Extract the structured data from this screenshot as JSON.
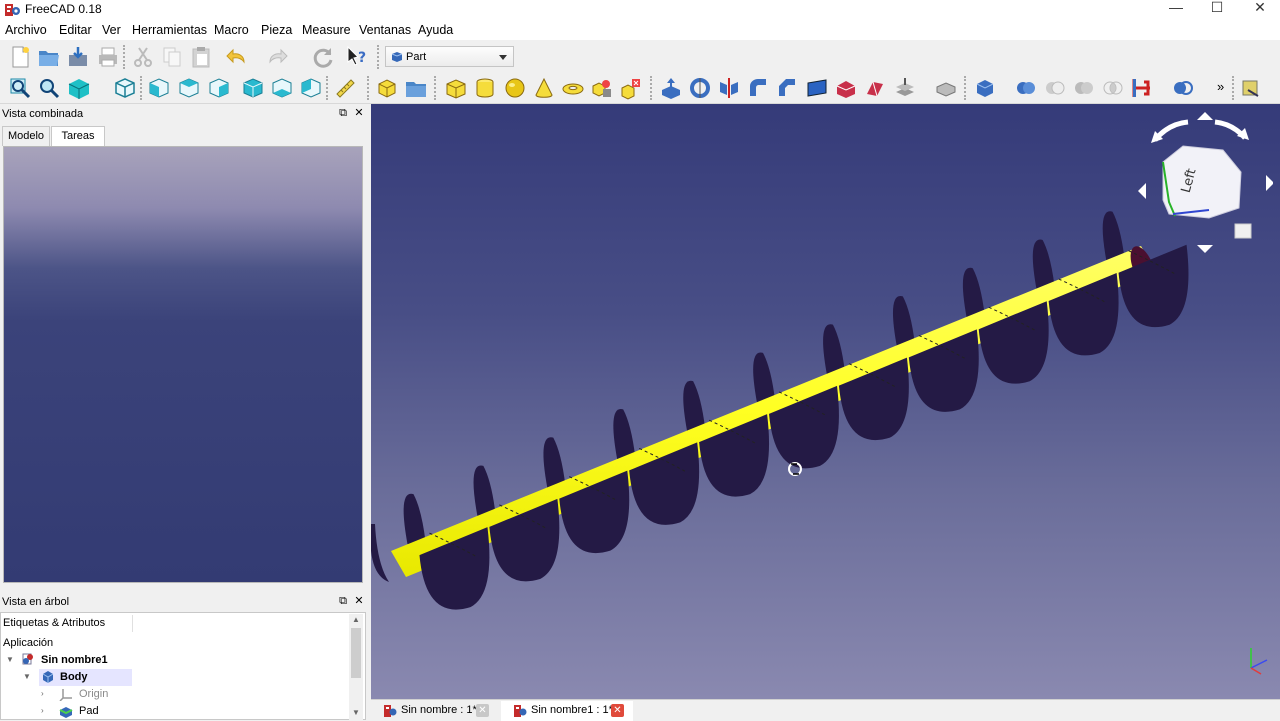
{
  "app": {
    "title": "FreeCAD 0.18",
    "window_buttons": [
      "—",
      "☐",
      "✕"
    ]
  },
  "menu": [
    "Archivo",
    "Editar",
    "Ver",
    "Herramientas",
    "Macro",
    "Pieza",
    "Measure",
    "Ventanas",
    "Ayuda"
  ],
  "workbench": {
    "selected": "Part"
  },
  "combo_view": {
    "title": "Vista combinada",
    "tabs": [
      "Modelo",
      "Tareas"
    ],
    "active_tab": "Tareas"
  },
  "tree_view": {
    "title": "Vista en árbol",
    "header": "Etiquetas & Atributos",
    "section": "Aplicación",
    "items": [
      {
        "label": "Sin nombre1",
        "bold": true
      },
      {
        "label": "Body",
        "bold": true
      },
      {
        "label": "Origin",
        "bold": false
      },
      {
        "label": "Pad",
        "bold": false
      }
    ]
  },
  "navigation_cube": {
    "face_label": "Left"
  },
  "document_tabs": [
    {
      "label": "Sin nombre : 1*",
      "active": false
    },
    {
      "label": "Sin nombre1 : 1*",
      "active": true
    }
  ],
  "toolbar_overflow": "»",
  "colors": {
    "shaft_yellow": "#ffff33",
    "flight_dark": "#241a45",
    "viewport_top": "#353b79",
    "viewport_bottom": "#8a89b0"
  }
}
